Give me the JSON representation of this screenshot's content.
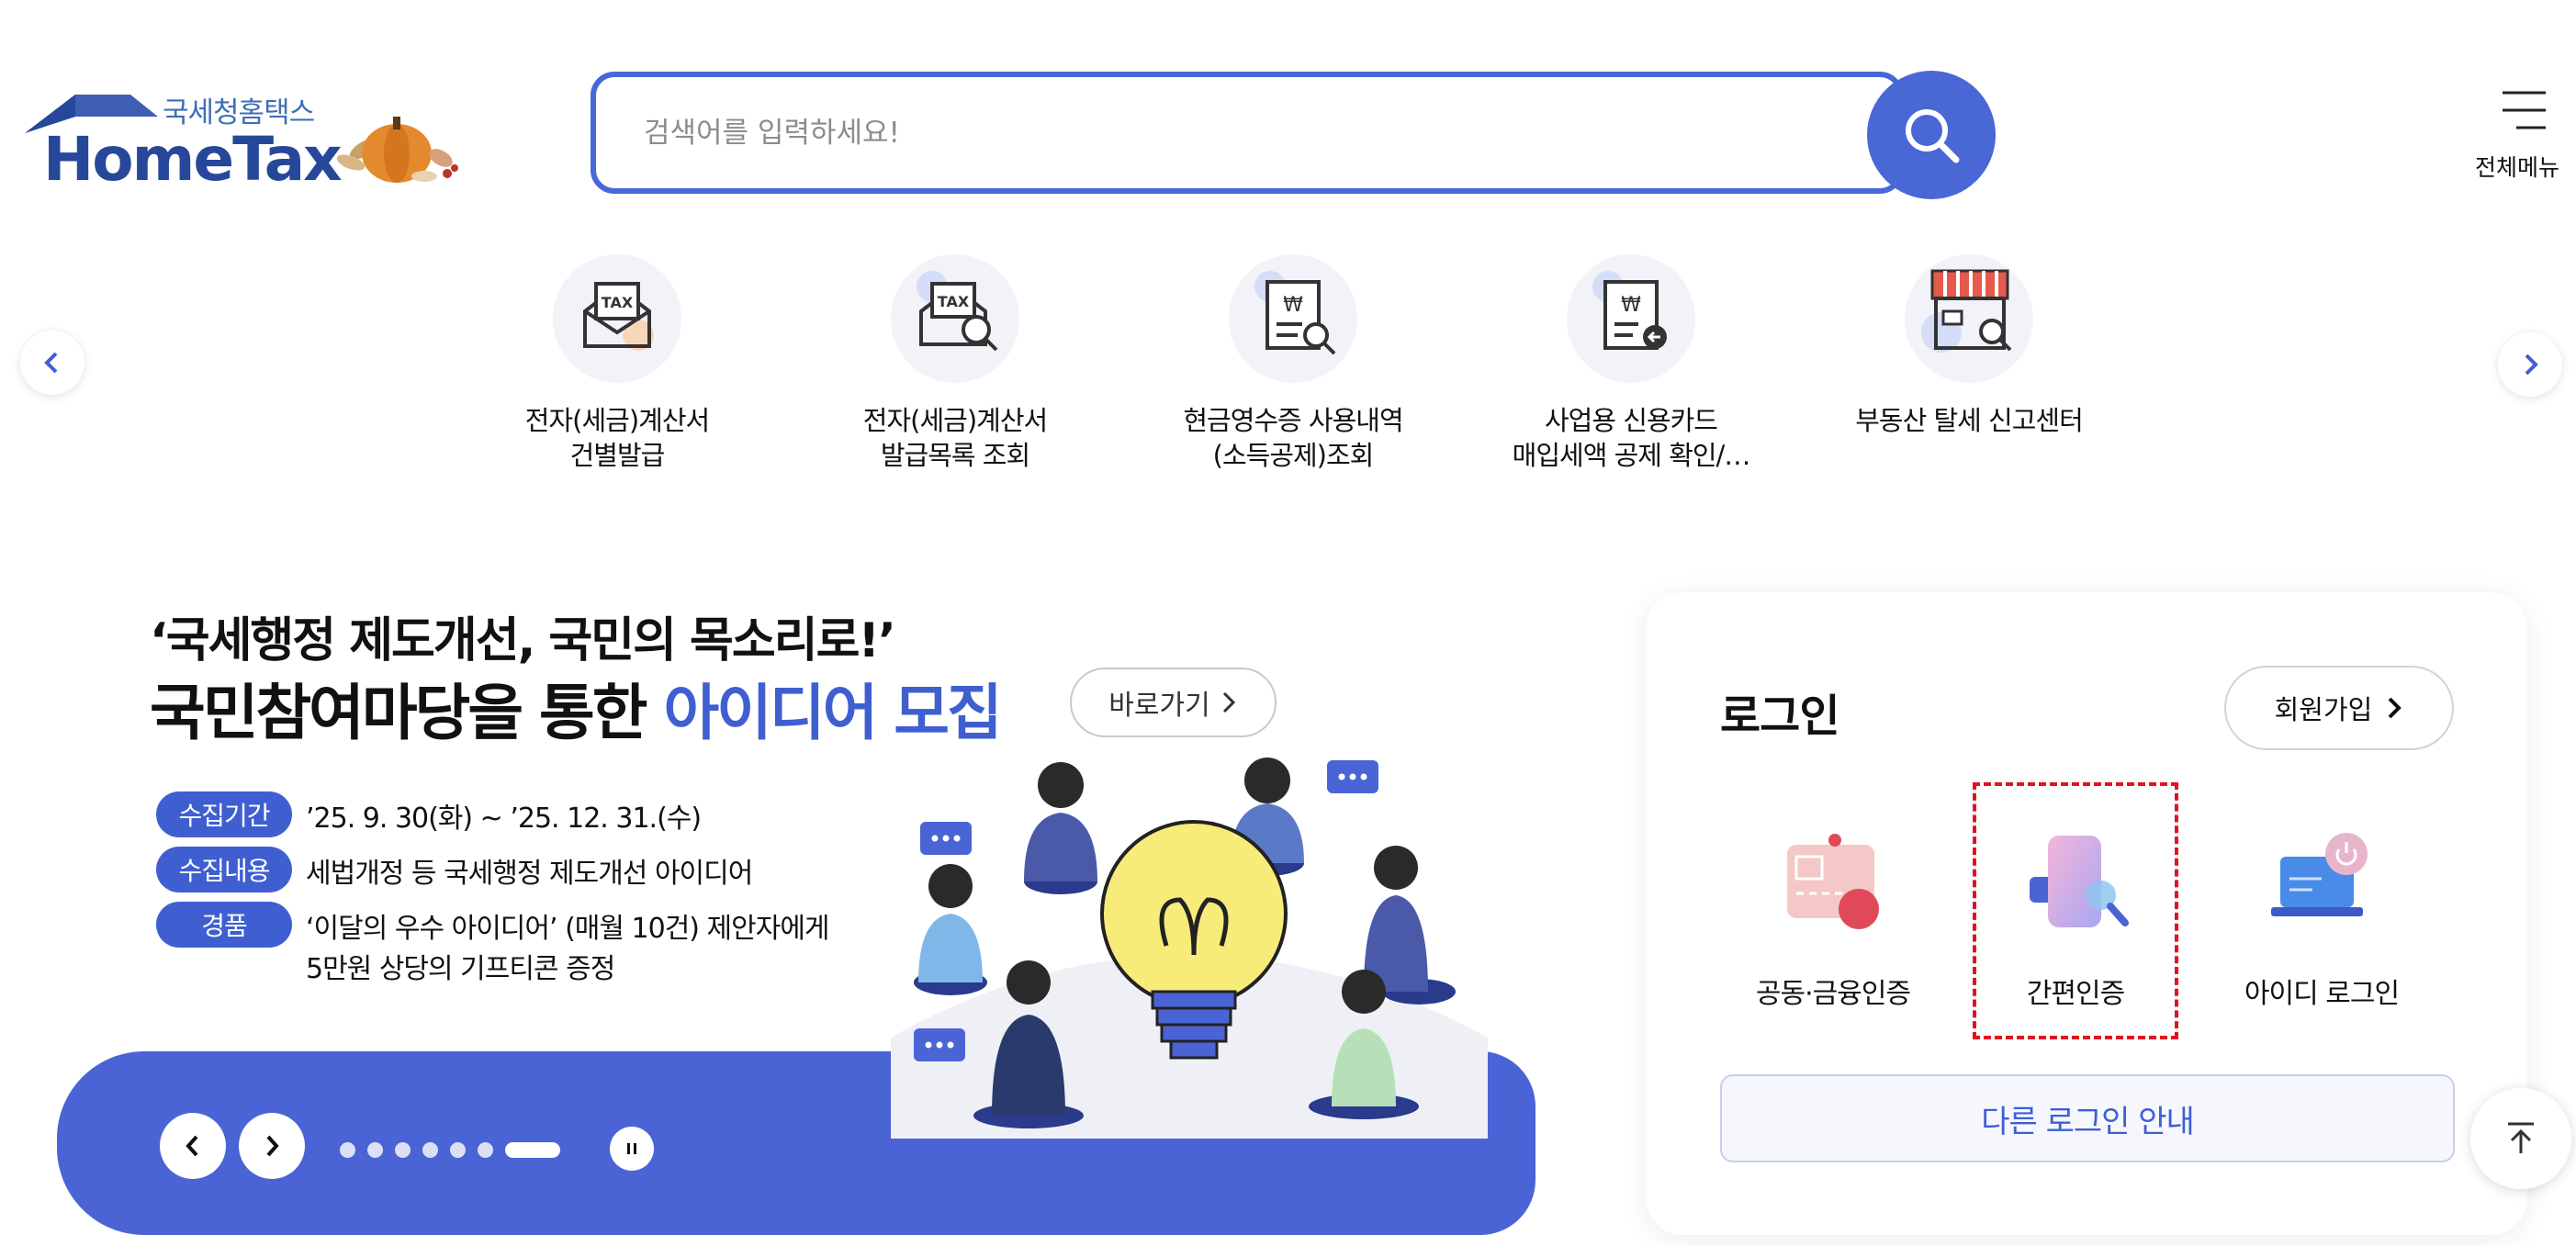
{
  "header": {
    "logo_sub": "국세청홈택스",
    "logo_main": "HomeTax",
    "search_placeholder": "검색어를 입력하세요!",
    "search_icon": "search-icon",
    "menu_label": "전체메뉴",
    "brand_color": "#4a67d6"
  },
  "quick_menu": {
    "items": [
      {
        "label": "전자(세금)계산서\n건별발급",
        "icon": "tax-envelope-icon"
      },
      {
        "label": "전자(세금)계산서\n발급목록 조회",
        "icon": "tax-envelope-search-icon"
      },
      {
        "label": "현금영수증 사용내역\n(소득공제)조회",
        "icon": "receipt-search-icon"
      },
      {
        "label": "사업용 신용카드\n매입세액 공제 확인/…",
        "icon": "receipt-return-icon"
      },
      {
        "label": "부동산 탈세 신고센터",
        "icon": "store-search-icon"
      }
    ]
  },
  "banner": {
    "line1": "‘국세행정 제도개선, 국민의 목소리로!’",
    "line2_prefix": "국민참여마당을 통한 ",
    "line2_highlight": "아이디어 모집",
    "go_label": "바로가기",
    "rows": [
      {
        "tag": "수집기간",
        "text": "’25. 9. 30(화) ~ ’25. 12. 31.(수)"
      },
      {
        "tag": "수집내용",
        "text": "세법개정 등 국세행정 제도개선 아이디어"
      },
      {
        "tag": "경품",
        "text": "‘이달의 우수 아이디어’ (매월 10건) 제안자에게"
      }
    ],
    "prize_line2": "5만원 상당의 기프티콘 증정",
    "slide_count": 7,
    "active_slide": 7,
    "accent_color": "#3f5fd1"
  },
  "login": {
    "title": "로그인",
    "join_label": "회원가입",
    "options": [
      {
        "label": "공동·금융인증",
        "icon": "certificate-card-icon"
      },
      {
        "label": "간편인증",
        "icon": "phone-search-icon"
      },
      {
        "label": "아이디 로그인",
        "icon": "laptop-power-icon"
      }
    ],
    "other_login_label": "다른 로그인 안내"
  }
}
